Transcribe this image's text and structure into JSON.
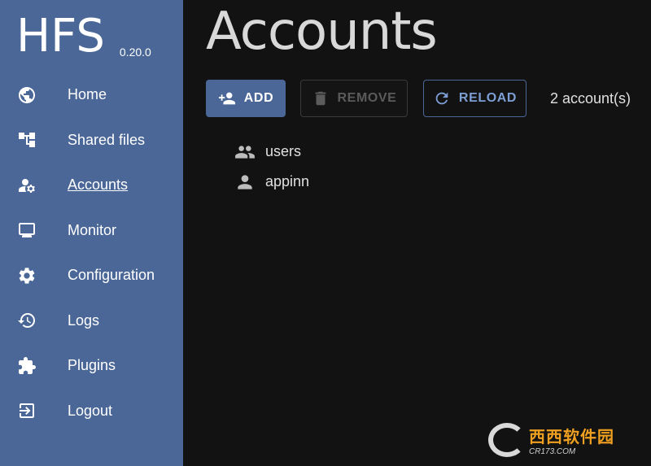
{
  "app": {
    "name": "HFS",
    "version": "0.20.0"
  },
  "sidebar": {
    "items": [
      {
        "label": "Home",
        "icon": "globe-icon"
      },
      {
        "label": "Shared files",
        "icon": "tree-icon"
      },
      {
        "label": "Accounts",
        "icon": "manage-accounts-icon",
        "active": true
      },
      {
        "label": "Monitor",
        "icon": "monitor-icon"
      },
      {
        "label": "Configuration",
        "icon": "gear-icon"
      },
      {
        "label": "Logs",
        "icon": "history-icon"
      },
      {
        "label": "Plugins",
        "icon": "puzzle-icon"
      },
      {
        "label": "Logout",
        "icon": "logout-icon"
      }
    ]
  },
  "main": {
    "title": "Accounts",
    "toolbar": {
      "add_label": "ADD",
      "remove_label": "REMOVE",
      "reload_label": "RELOAD",
      "count_text": "2 account(s)"
    },
    "accounts": [
      {
        "name": "users",
        "icon": "group-icon"
      },
      {
        "name": "appinn",
        "icon": "person-icon"
      }
    ]
  },
  "watermark": {
    "brand": "西西软件园",
    "url": "CR173.COM"
  },
  "colors": {
    "sidebar": "#4a6797",
    "background": "#121212",
    "accent_text": "#7d9ed4"
  }
}
